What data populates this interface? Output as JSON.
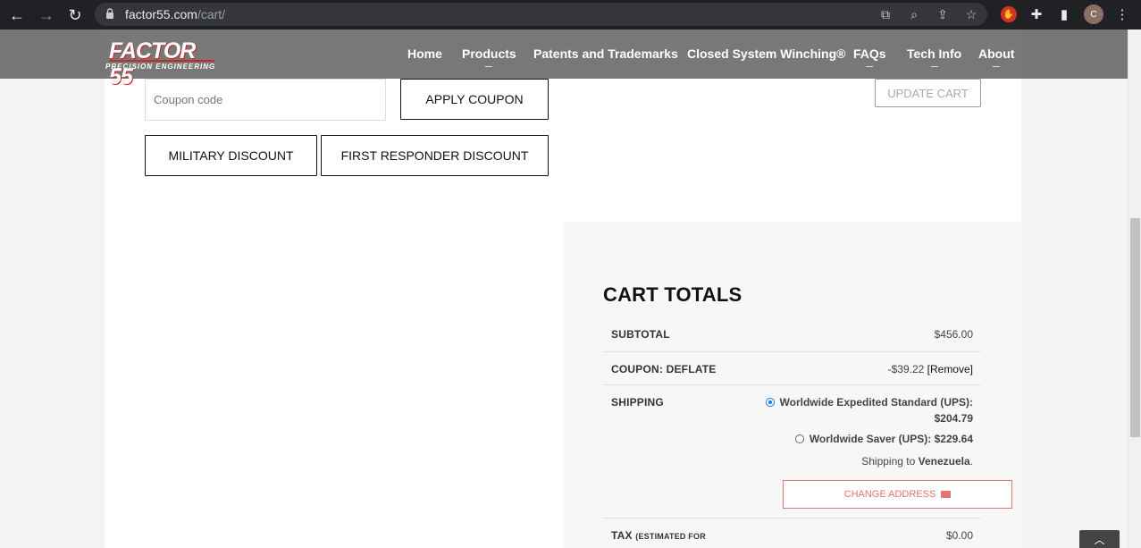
{
  "browser": {
    "url_host": "factor55.com",
    "url_path": "/cart/",
    "avatar_letter": "C"
  },
  "header": {
    "logo_text": "FACTOR 55",
    "logo_tagline": "PRECISION ENGINEERING",
    "nav": [
      {
        "label": "Home"
      },
      {
        "label": "Products"
      },
      {
        "label": "Patents and Trademarks"
      },
      {
        "label": "Closed System Winching®"
      },
      {
        "label": "FAQs"
      },
      {
        "label": "Tech Info"
      },
      {
        "label": "About"
      }
    ]
  },
  "coupon": {
    "placeholder": "Coupon code",
    "apply_label": "APPLY COUPON",
    "update_label": "UPDATE CART",
    "military_label": "MILITARY DISCOUNT",
    "responder_label": "FIRST RESPONDER DISCOUNT"
  },
  "totals": {
    "title": "CART TOTALS",
    "subtotal_label": "SUBTOTAL",
    "subtotal_value": "$456.00",
    "coupon_label": "COUPON: DEFLATE",
    "coupon_value": "-$39.22",
    "coupon_remove": "[Remove]",
    "shipping_label": "SHIPPING",
    "shipping_options": [
      {
        "line1": "Worldwide Expedited Standard (UPS):",
        "line2": "$204.79",
        "selected": true
      },
      {
        "line1": "Worldwide Saver (UPS): $229.64",
        "selected": false
      }
    ],
    "shipping_to_prefix": "Shipping to",
    "shipping_to_country": "Venezuela",
    "change_address_label": "CHANGE ADDRESS",
    "tax_label": "TAX",
    "tax_note": "(ESTIMATED FOR",
    "tax_value": "$0.00"
  },
  "colors": {
    "accent": "#e57373",
    "brand_red": "#c62828"
  }
}
